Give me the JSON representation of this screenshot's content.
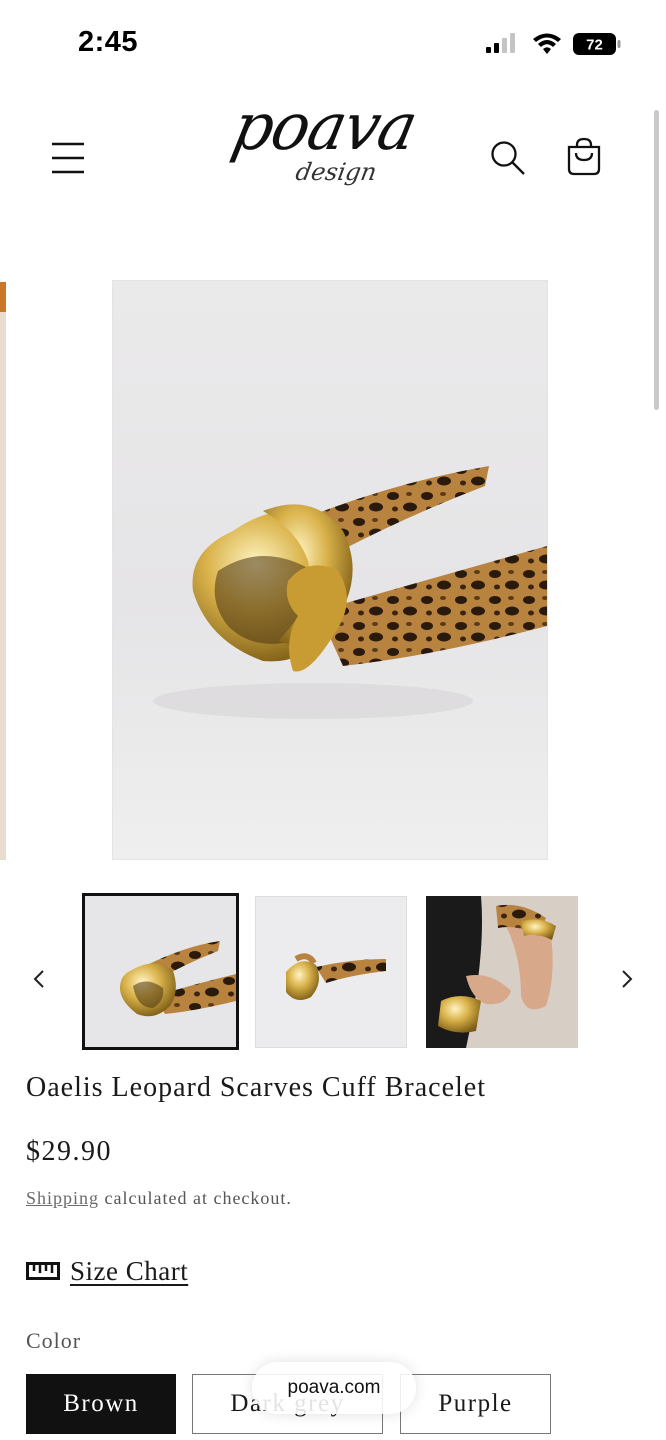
{
  "status_bar": {
    "time": "2:45",
    "battery": "72"
  },
  "header": {
    "logo_main": "poava",
    "logo_sub": "design"
  },
  "product": {
    "title": "Oaelis Leopard Scarves Cuff Bracelet",
    "price": "$29.90",
    "shipping_link": "Shipping",
    "shipping_rest": " calculated at checkout.",
    "size_chart": "Size Chart",
    "color_label": "Color",
    "colors": [
      "Brown",
      "Dark grey",
      "Purple"
    ],
    "selected_color": "Brown"
  },
  "gallery": {
    "thumbnail_count": 3,
    "selected_index": 0
  },
  "browser": {
    "url": "poava.com"
  },
  "colors": {
    "accent": "#111111",
    "gold": "#c9a23a",
    "leopard_base": "#b07a3c"
  }
}
